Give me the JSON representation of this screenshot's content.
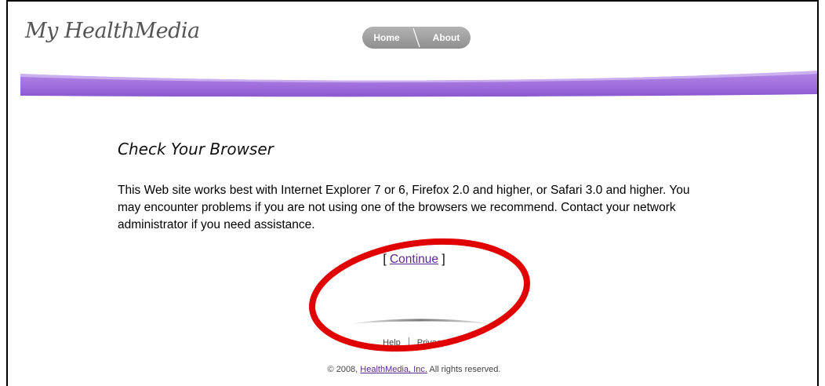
{
  "header": {
    "logo": "My HealthMedia",
    "nav": {
      "home": "Home",
      "about": "About"
    }
  },
  "main": {
    "title": "Check Your Browser",
    "message": "This Web site works best with Internet Explorer 7 or 6, Firefox 2.0 and higher, or Safari 3.0 and higher. You may encounter problems if you are not using one of the browsers we recommend. Contact your network administrator if you need assistance.",
    "continue": {
      "open": "[ ",
      "label": "Continue",
      "close": " ]"
    }
  },
  "footer": {
    "help": "Help",
    "privacy": "Privacy",
    "copyright_prefix": "© 2008, ",
    "company_link": "HealthMedia, Inc.",
    "copyright_suffix": " All rights reserved."
  },
  "colors": {
    "banner": "#a77be0",
    "link": "#5b2a8f",
    "annotation": "#e00000",
    "nav_pill": "#a0a0a0"
  }
}
